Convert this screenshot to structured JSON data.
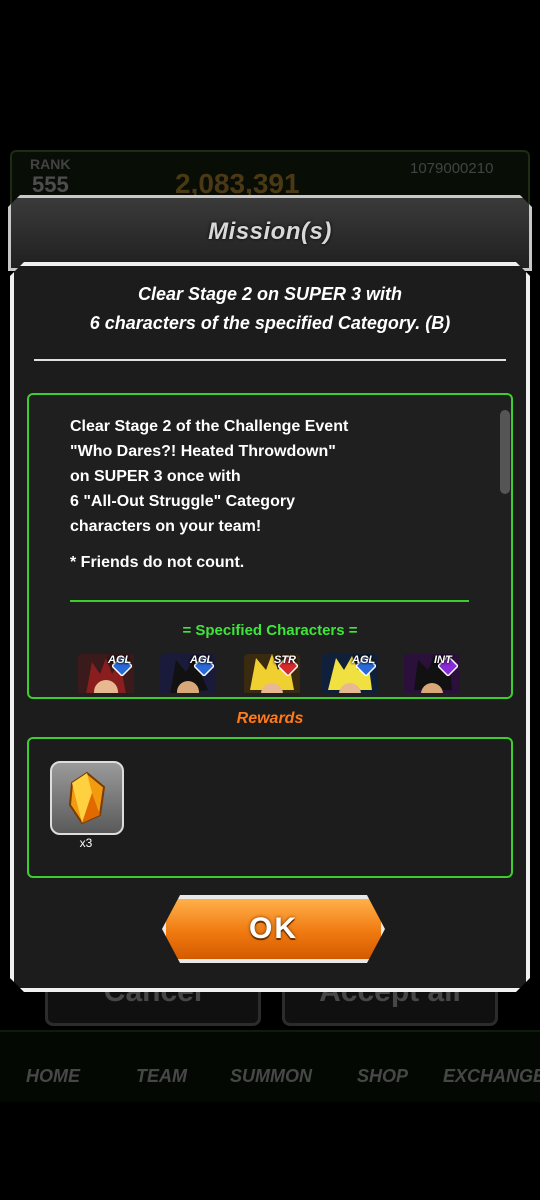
{
  "background": {
    "rank_label": "RANK",
    "rank_value": "555",
    "power_value": "2,083,391",
    "player_id": "1079000210",
    "cancel_label": "Cancel",
    "accept_all_label": "Accept all",
    "nav": [
      "HOME",
      "TEAM",
      "SUMMON",
      "SHOP",
      "EXCHANGE"
    ]
  },
  "header": {
    "title": "Mission(s)"
  },
  "mission": {
    "title_line1": "Clear Stage 2 on SUPER 3 with",
    "title_line2": "6 characters of the specified Category. (B)",
    "description": "Clear Stage 2 of the Challenge Event\n\"Who Dares?! Heated Throwdown\"\non SUPER 3 once with\n6 \"All-Out Struggle\" Category\ncharacters on your team!",
    "note": "* Friends do not count.",
    "specified_title": "= Specified Characters =",
    "characters": [
      {
        "type": "AGL",
        "color": "#2a6ad8",
        "icon": "character-portrait-icon"
      },
      {
        "type": "AGL",
        "color": "#2a6ad8",
        "icon": "character-portrait-icon"
      },
      {
        "type": "STR",
        "color": "#d82a2a",
        "icon": "character-portrait-icon"
      },
      {
        "type": "AGL",
        "color": "#2a6ad8",
        "icon": "character-portrait-icon"
      },
      {
        "type": "INT",
        "color": "#8a2ad8",
        "icon": "character-portrait-icon"
      }
    ]
  },
  "rewards": {
    "label": "Rewards",
    "items": [
      {
        "icon": "dragon-stone-icon",
        "count": "x3"
      }
    ]
  },
  "ok_label": "OK",
  "colors": {
    "panel_border": "#3ccf2c",
    "accent_green": "#3fe53a",
    "rewards_orange": "#ff7a1a",
    "button_orange": "#f07a10"
  }
}
